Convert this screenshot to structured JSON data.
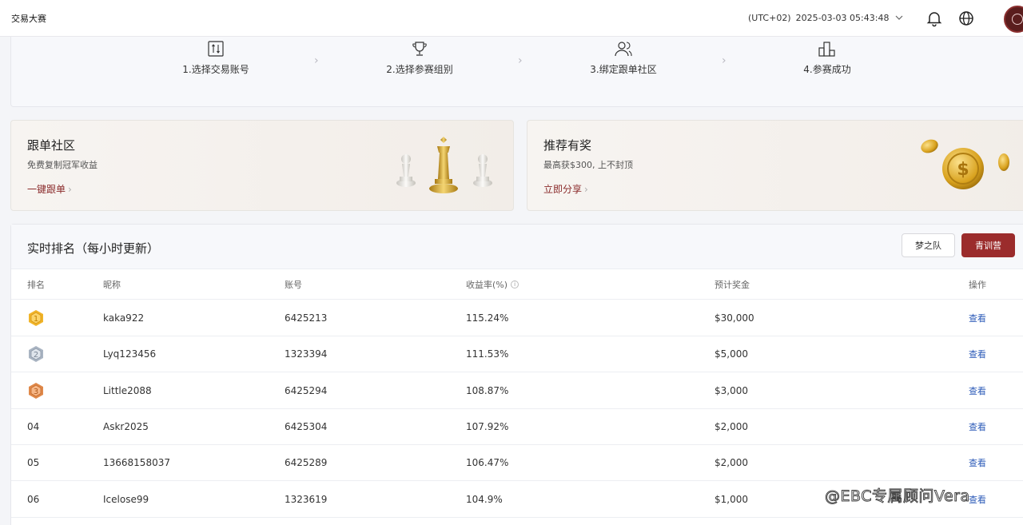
{
  "header": {
    "app_title": "交易大赛",
    "timezone": "(UTC+02)",
    "datetime": "2025-03-03 05:43:48"
  },
  "steps": [
    {
      "label": "1.选择交易账号",
      "icon": "account-switch-icon"
    },
    {
      "label": "2.选择参赛组别",
      "icon": "trophy-icon"
    },
    {
      "label": "3.绑定跟单社区",
      "icon": "users-icon"
    },
    {
      "label": "4.参赛成功",
      "icon": "podium-icon"
    }
  ],
  "promos": {
    "copy": {
      "title": "跟单社区",
      "subtitle": "免费复制冠军收益",
      "link": "一键跟单"
    },
    "referral": {
      "title": "推荐有奖",
      "subtitle": "最高获$300, 上不封顶",
      "link": "立即分享"
    }
  },
  "ranking": {
    "title": "实时排名（每小时更新）",
    "btn_team": "梦之队",
    "btn_camp": "青训营",
    "columns": {
      "rank": "排名",
      "nickname": "昵称",
      "account": "账号",
      "return": "收益率(%)",
      "prize": "预计奖金",
      "action": "操作"
    },
    "rows": [
      {
        "rank": "1",
        "nickname": "kaka922",
        "account": "6425213",
        "return": "115.24%",
        "prize": "$30,000",
        "action": "查看"
      },
      {
        "rank": "2",
        "nickname": "Lyq123456",
        "account": "1323394",
        "return": "111.53%",
        "prize": "$5,000",
        "action": "查看"
      },
      {
        "rank": "3",
        "nickname": "Little2088",
        "account": "6425294",
        "return": "108.87%",
        "prize": "$3,000",
        "action": "查看"
      },
      {
        "rank": "04",
        "nickname": "Askr2025",
        "account": "6425304",
        "return": "107.92%",
        "prize": "$2,000",
        "action": "查看"
      },
      {
        "rank": "05",
        "nickname": "13668158037",
        "account": "6425289",
        "return": "106.47%",
        "prize": "$2,000",
        "action": "查看"
      },
      {
        "rank": "06",
        "nickname": "Icelose99",
        "account": "1323619",
        "return": "104.9%",
        "prize": "$1,000",
        "action": "查看"
      }
    ]
  },
  "watermark": "@EBC专属顾问Vera",
  "colors": {
    "accent": "#9b2c2c",
    "link": "#2d5bb8",
    "gold": "#f0b429",
    "silver": "#a9b4c2",
    "bronze": "#e0894a"
  }
}
